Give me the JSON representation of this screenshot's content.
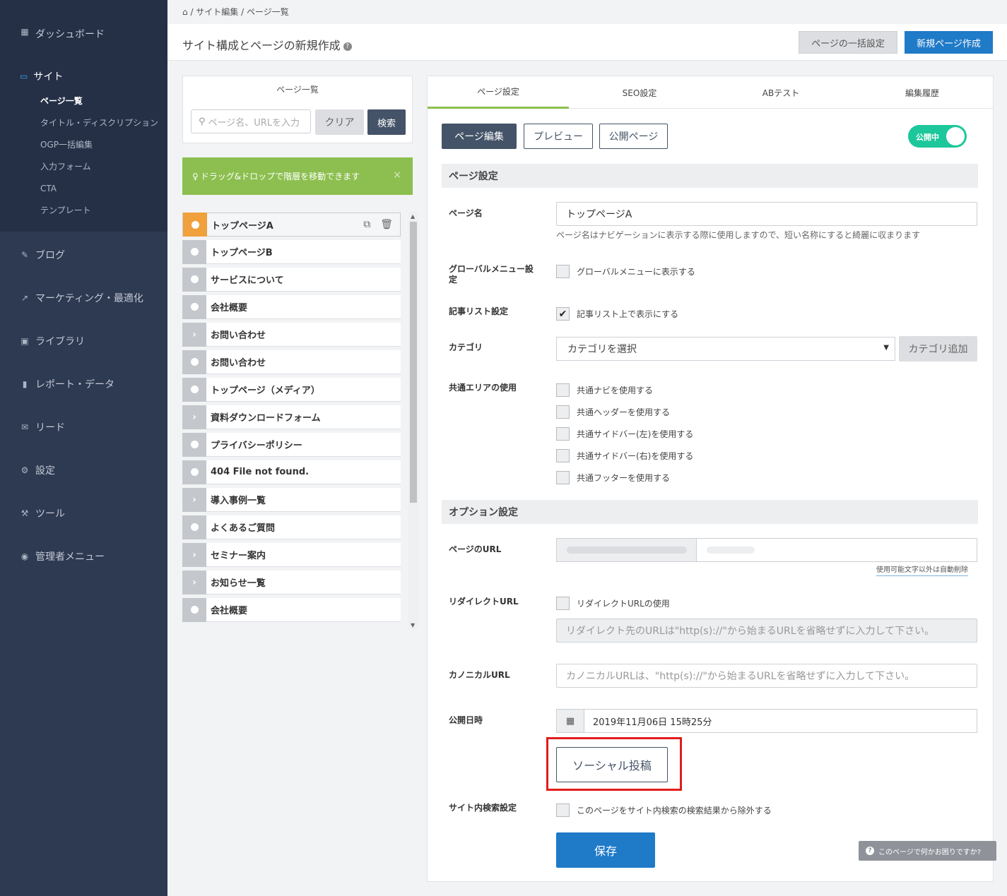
{
  "sidebar": {
    "dashboard": "ダッシュボード",
    "site": "サイト",
    "site_sub": [
      "ページ一覧",
      "タイトル・ディスクリプション",
      "OGP一括編集",
      "入力フォーム",
      "CTA",
      "テンプレート"
    ],
    "items": [
      "ブログ",
      "マーケティング・最適化",
      "ライブラリ",
      "レポート・データ",
      "リード",
      "設定",
      "ツール",
      "管理者メニュー"
    ]
  },
  "breadcrumb": {
    "home_icon": "home-icon",
    "text": "/ サイト編集 / ページ一覧"
  },
  "header": {
    "title": "サイト構成とページの新規作成",
    "bulk_button": "ページの一括設定",
    "new_button": "新規ページ作成"
  },
  "page_list": {
    "title": "ページ一覧",
    "search_placeholder": "ページ名、URLを入力",
    "clear": "クリア",
    "search": "検索",
    "drag_tip": "ドラッグ&ドロップで階層を移動できます",
    "close": "×",
    "rows": [
      {
        "label": "トップページA",
        "type": "dot",
        "active": true
      },
      {
        "label": "トップページB",
        "type": "dot"
      },
      {
        "label": "サービスについて",
        "type": "dot"
      },
      {
        "label": "会社概要",
        "type": "dot"
      },
      {
        "label": "お問い合わせ",
        "type": "chev"
      },
      {
        "label": "お問い合わせ",
        "type": "dot"
      },
      {
        "label": "トップページ（メディア）",
        "type": "dot"
      },
      {
        "label": "資料ダウンロードフォーム",
        "type": "chev"
      },
      {
        "label": "プライバシーポリシー",
        "type": "dot"
      },
      {
        "label": "404 File not found.",
        "type": "dot"
      },
      {
        "label": "導入事例一覧",
        "type": "chev"
      },
      {
        "label": "よくあるご質問",
        "type": "dot"
      },
      {
        "label": "セミナー案内",
        "type": "chev"
      },
      {
        "label": "お知らせ一覧",
        "type": "chev"
      },
      {
        "label": "会社概要",
        "type": "dot"
      }
    ]
  },
  "tabs": [
    "ページ設定",
    "SEO設定",
    "ABテスト",
    "編集履歴"
  ],
  "actions": {
    "edit": "ページ編集",
    "preview": "プレビュー",
    "public": "公開ページ",
    "toggle": "公開中"
  },
  "page_settings": {
    "section": "ページ設定",
    "name_label": "ページ名",
    "name_value": "トップページA",
    "name_hint": "ページ名はナビゲーションに表示する際に使用しますので、短い名称にすると綺麗に収まります",
    "global_label": "グローバルメニュー設定",
    "global_check": "グローバルメニューに表示する",
    "article_label": "記事リスト設定",
    "article_check": "記事リスト上で表示にする",
    "category_label": "カテゴリ",
    "category_select": "カテゴリを選択",
    "category_add": "カテゴリ追加",
    "common_label": "共通エリアの使用",
    "common_checks": [
      "共通ナビを使用する",
      "共通ヘッダーを使用する",
      "共通サイドバー(左)を使用する",
      "共通サイドバー(右)を使用する",
      "共通フッターを使用する"
    ]
  },
  "options": {
    "section": "オプション設定",
    "url_label": "ページのURL",
    "url_note": "使用可能文字以外は自動削除",
    "redirect_label": "リダイレクトURL",
    "redirect_check": "リダイレクトURLの使用",
    "redirect_placeholder": "リダイレクト先のURLは\"http(s)://\"から始まるURLを省略せずに入力して下さい。",
    "canonical_label": "カノニカルURL",
    "canonical_placeholder": "カノニカルURLは、\"http(s)://\"から始まるURLを省略せずに入力して下さい。",
    "date_label": "公開日時",
    "date_value": "2019年11月06日 15時25分",
    "social_button": "ソーシャル投稿",
    "search_label": "サイト内検索設定",
    "search_check": "このページをサイト内検索の検索結果から除外する",
    "save": "保存"
  },
  "help_float": "このページで何かお困りですか?"
}
